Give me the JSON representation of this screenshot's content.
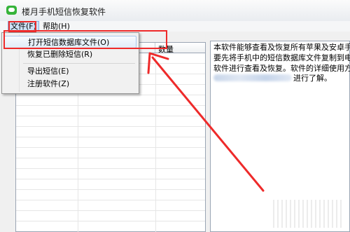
{
  "window": {
    "title": "楼月手机短信恢复软件"
  },
  "menubar": {
    "file": "文件(F)",
    "help": "帮助(H)"
  },
  "list": {
    "columns": [
      "",
      "数量"
    ]
  },
  "dropdown": {
    "items": [
      {
        "label": "打开短信数据库文件(O)",
        "highlighted": true
      },
      {
        "label": "恢复已删除短信(R)",
        "highlighted": false
      },
      {
        "label": "导出短信(E)",
        "highlighted": false
      },
      {
        "label": "注册软件(Z)",
        "highlighted": false
      }
    ]
  },
  "info": {
    "lines": [
      "本软件能够查看及恢复所有苹果及安卓手机",
      "要先将手机中的短信数据库文件复制到电脑",
      "软件进行查看及恢复。软件的详细使用方法",
      "进行了解。"
    ]
  },
  "colors": {
    "annotation": "#ee2a2a",
    "accent": "#35b339"
  }
}
